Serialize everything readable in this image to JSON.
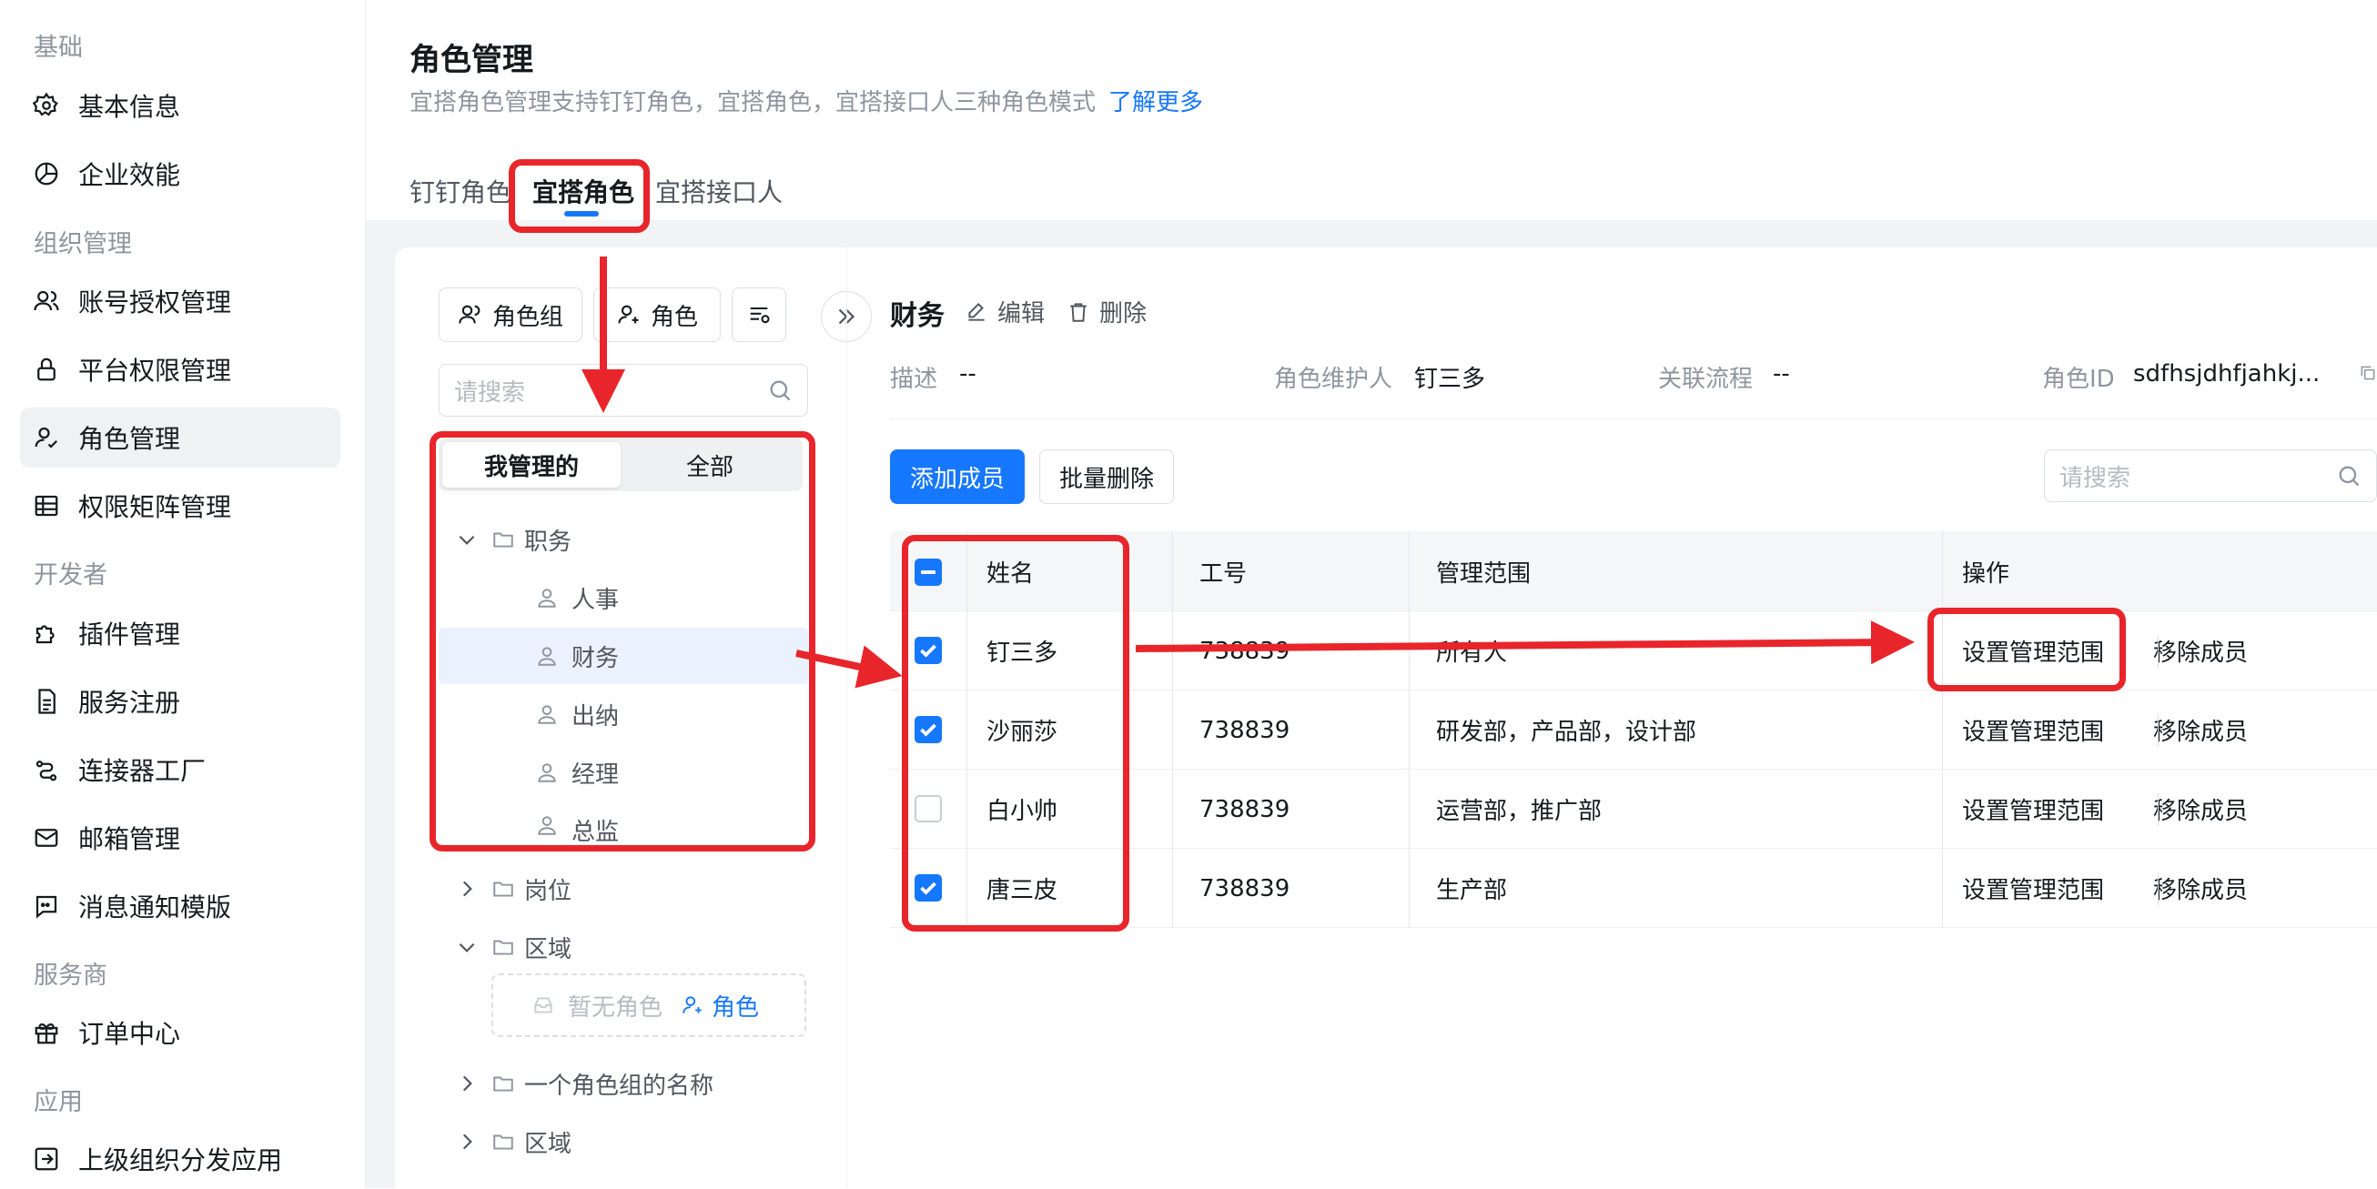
{
  "sidebar": {
    "sections": [
      "基础",
      "组织管理",
      "开发者",
      "服务商",
      "应用"
    ],
    "items": [
      {
        "label": "基本信息",
        "icon": "gear-icon"
      },
      {
        "label": "企业效能",
        "icon": "pie-chart-icon"
      },
      {
        "label": "账号授权管理",
        "icon": "users-icon"
      },
      {
        "label": "平台权限管理",
        "icon": "lock-icon"
      },
      {
        "label": "角色管理",
        "icon": "user-check-icon",
        "active": true
      },
      {
        "label": "权限矩阵管理",
        "icon": "table-icon"
      },
      {
        "label": "插件管理",
        "icon": "puzzle-icon"
      },
      {
        "label": "服务注册",
        "icon": "document-icon"
      },
      {
        "label": "连接器工厂",
        "icon": "connector-icon"
      },
      {
        "label": "邮箱管理",
        "icon": "mail-icon"
      },
      {
        "label": "消息通知模版",
        "icon": "message-icon"
      },
      {
        "label": "订单中心",
        "icon": "gift-icon"
      },
      {
        "label": "上级组织分发应用",
        "icon": "export-icon"
      }
    ]
  },
  "header": {
    "title": "角色管理",
    "subtitle": "宜搭角色管理支持钉钉角色，宜搭角色，宜搭接口人三种角色模式",
    "learn_more": "了解更多",
    "tabs": [
      "钉钉角色",
      "宜搭角色",
      "宜搭接口人"
    ],
    "active_tab": 1
  },
  "left": {
    "btn_group": "角色组",
    "btn_role": "角色",
    "search_placeholder": "请搜索",
    "seg": [
      "我管理的",
      "全部"
    ],
    "tree": {
      "group1": "职务",
      "roles": [
        "人事",
        "财务",
        "出纳",
        "经理",
        "总监"
      ],
      "group2": "岗位",
      "group3": "区域",
      "empty": "暂无角色",
      "add_role": "角色",
      "group4": "一个角色组的名称",
      "group5": "区域"
    }
  },
  "detail": {
    "role_name": "财务",
    "edit": "编辑",
    "delete": "删除",
    "desc_label": "描述",
    "desc_value": "--",
    "maintainer_label": "角色维护人",
    "maintainer_value": "钉三多",
    "flow_label": "关联流程",
    "flow_value": "--",
    "id_label": "角色ID",
    "id_value": "sdfhsjdhfjahkj..."
  },
  "toolbar": {
    "add_member": "添加成员",
    "batch_delete": "批量删除",
    "search_placeholder": "请搜索"
  },
  "table": {
    "headers": [
      "姓名",
      "工号",
      "管理范围",
      "操作"
    ],
    "rows": [
      {
        "name": "钉三多",
        "id": "738839",
        "scope": "所有人",
        "checked": true
      },
      {
        "name": "沙丽莎",
        "id": "738839",
        "scope": "研发部，产品部，设计部",
        "checked": true
      },
      {
        "name": "白小帅",
        "id": "738839",
        "scope": "运营部，推广部",
        "checked": false
      },
      {
        "name": "唐三皮",
        "id": "738839",
        "scope": "生产部",
        "checked": true
      }
    ],
    "action_set": "设置管理范围",
    "action_remove": "移除成员"
  },
  "colors": {
    "accent": "#1677ff",
    "annotation": "#e8252b"
  }
}
